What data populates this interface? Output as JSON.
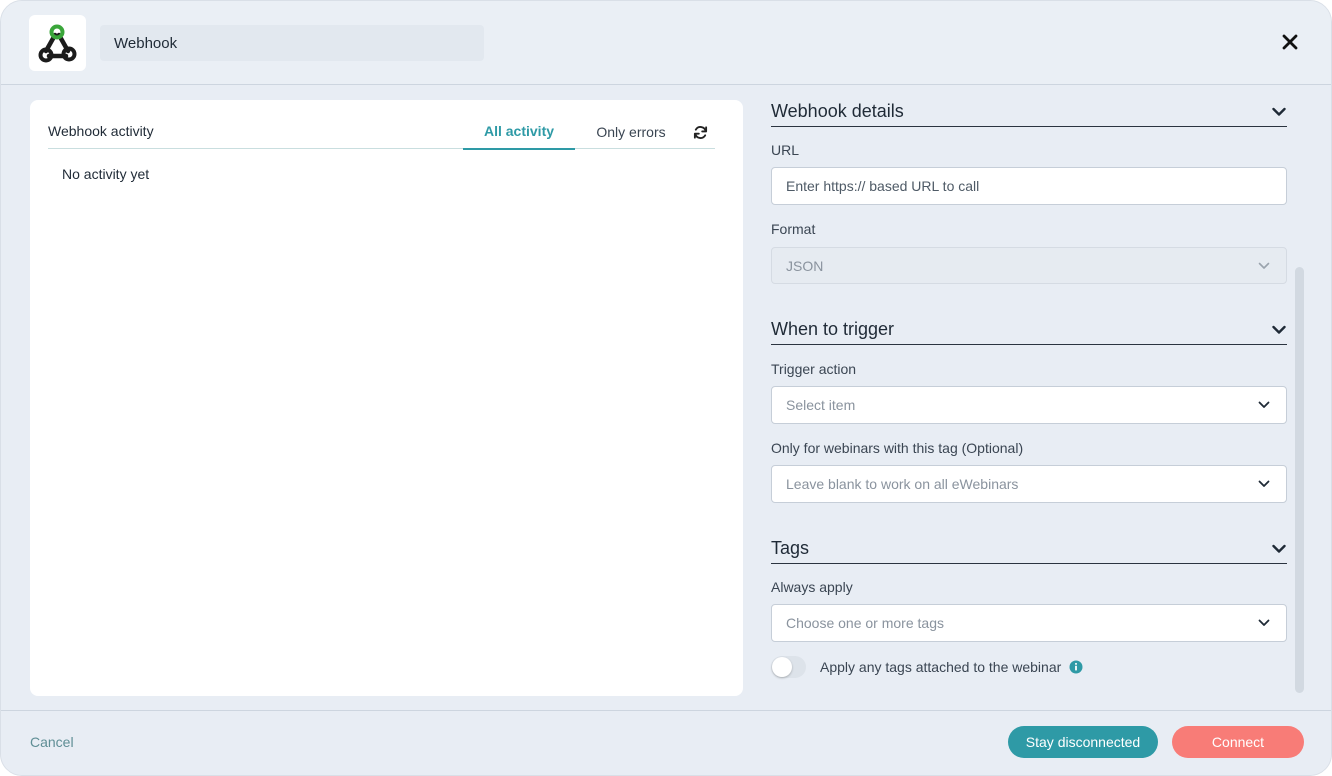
{
  "header": {
    "name_value": "Webhook",
    "logo_icon": "webhook-logo-icon",
    "close_icon": "close-icon"
  },
  "activity": {
    "title": "Webhook activity",
    "tabs": [
      {
        "label": "All activity",
        "active": true
      },
      {
        "label": "Only errors",
        "active": false
      }
    ],
    "refresh_icon": "refresh-icon",
    "empty_text": "No activity yet"
  },
  "details": {
    "title": "Webhook details",
    "url_label": "URL",
    "url_placeholder": "Enter https:// based URL to call",
    "url_value": "",
    "format_label": "Format",
    "format_value": "JSON"
  },
  "trigger": {
    "title": "When to trigger",
    "action_label": "Trigger action",
    "action_placeholder": "Select item",
    "tag_label": "Only for webinars with this tag (Optional)",
    "tag_placeholder": "Leave blank to work on all eWebinars"
  },
  "tags": {
    "title": "Tags",
    "always_label": "Always apply",
    "always_placeholder": "Choose one or more tags",
    "toggle_label": "Apply any tags attached to the webinar",
    "toggle_on": false
  },
  "footer": {
    "cancel_label": "Cancel",
    "stay_label": "Stay disconnected",
    "connect_label": "Connect"
  },
  "colors": {
    "accent": "#2e9aa6",
    "connect": "#f87c77",
    "background": "#e8edf4"
  }
}
